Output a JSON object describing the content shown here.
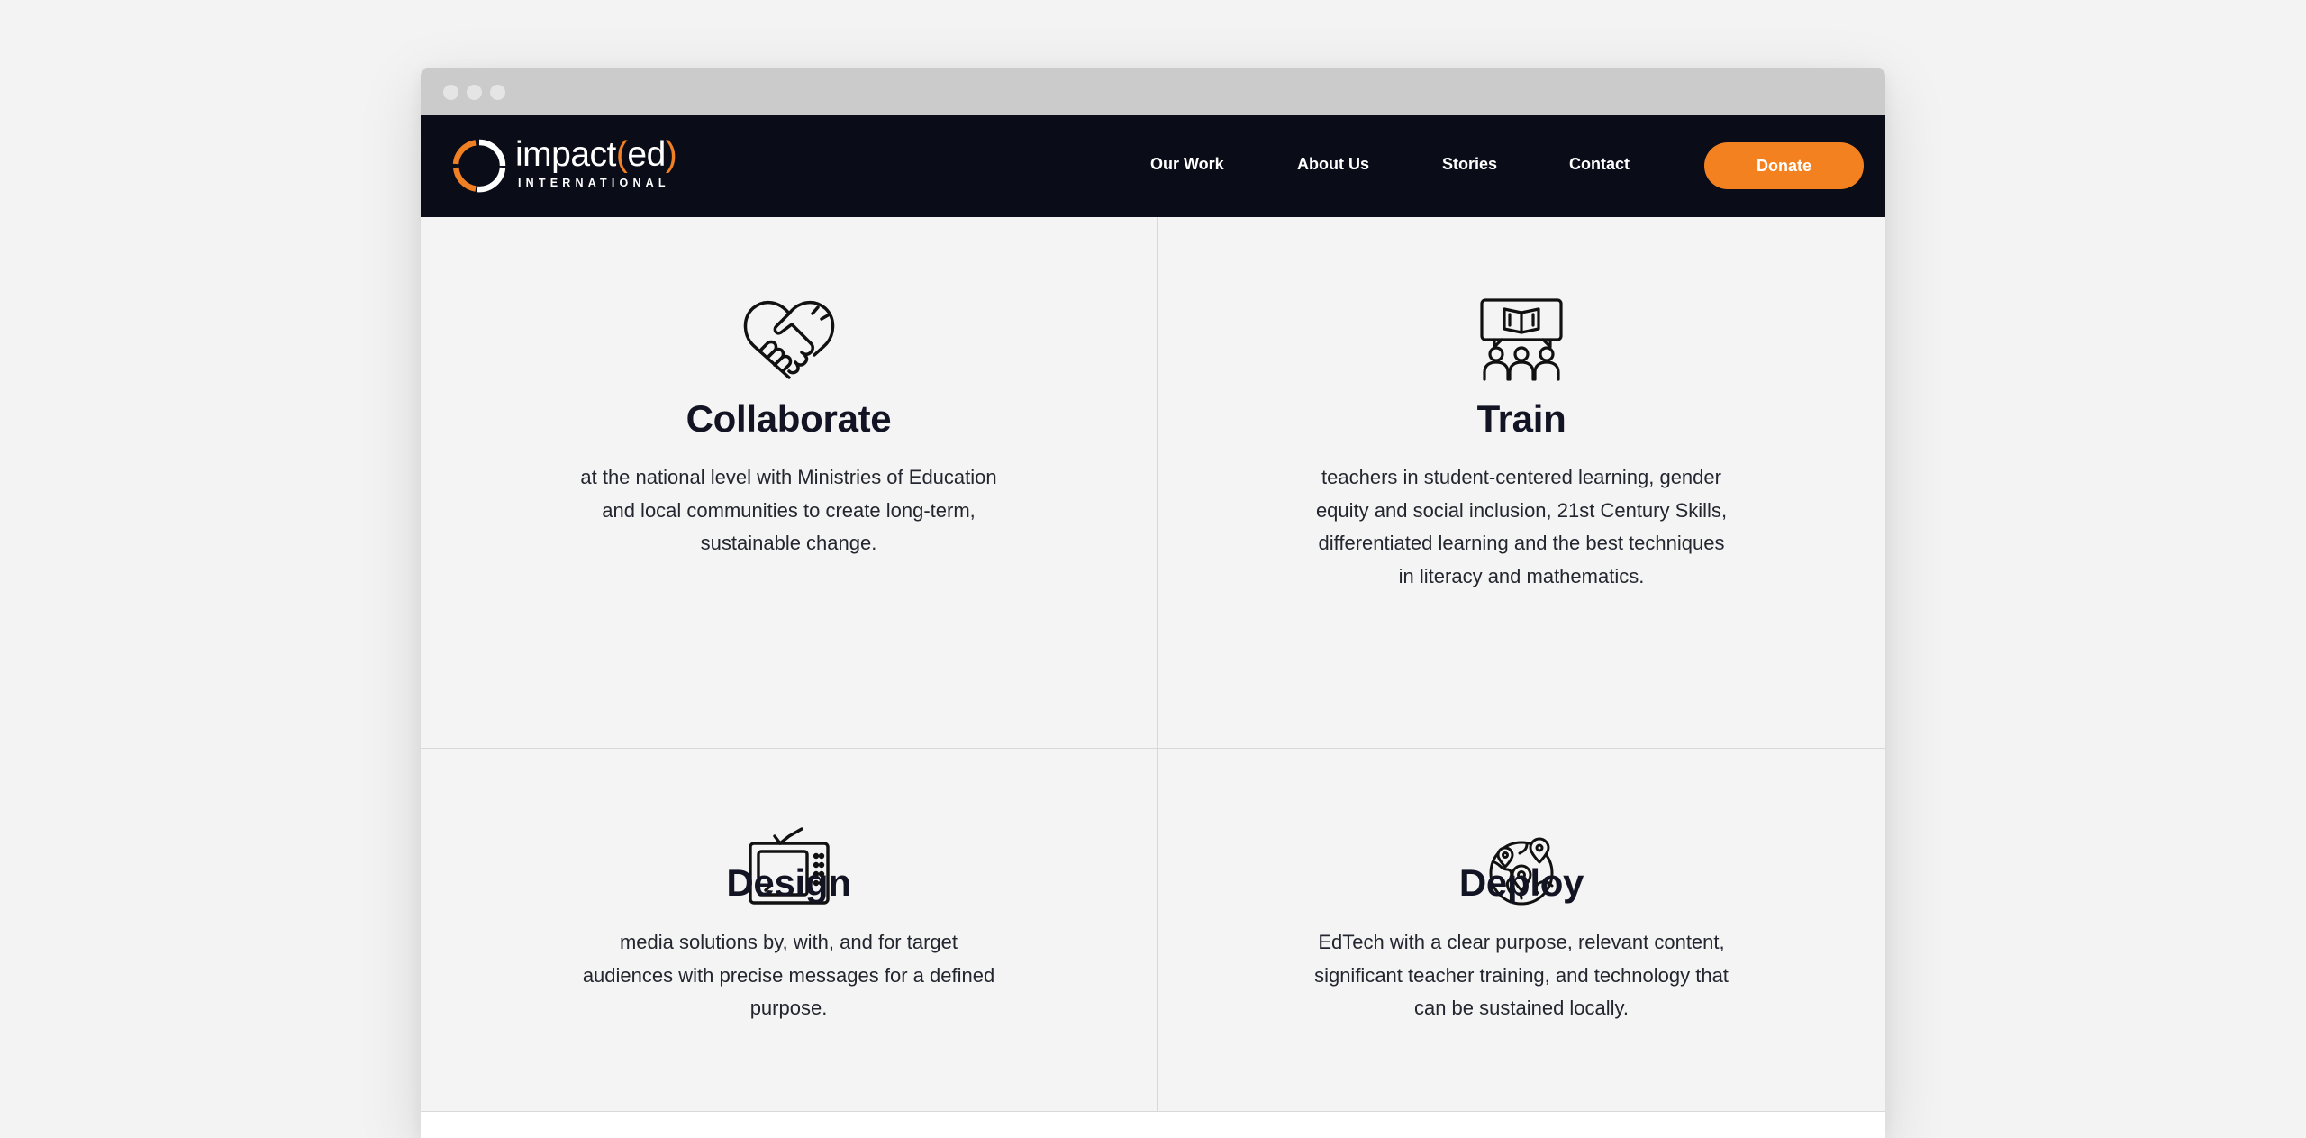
{
  "window": {
    "controls": [
      "close",
      "minimize",
      "maximize"
    ]
  },
  "brand": {
    "logo_text_main": "impact",
    "logo_text_open": "(",
    "logo_text_ed": "ed",
    "logo_text_close": ")",
    "logo_subtitle": "INTERNATIONAL",
    "accent_color": "#f4811f",
    "nav_background": "#0a0c18"
  },
  "nav": {
    "items": [
      {
        "label": "Our Work"
      },
      {
        "label": "About Us"
      },
      {
        "label": "Stories"
      },
      {
        "label": "Contact"
      }
    ],
    "donate_label": "Donate"
  },
  "features": [
    {
      "icon": "handshake-heart-icon",
      "title": "Collaborate",
      "lines": [
        "at the national level with Ministries of Education",
        "and local communities to create long-term,",
        "sustainable change."
      ]
    },
    {
      "icon": "teacher-students-book-icon",
      "title": "Train",
      "lines": [
        "teachers in student-centered learning, gender",
        "equity and social inclusion, 21st Century Skills,",
        "differentiated learning and the best techniques",
        "in literacy and mathematics."
      ]
    },
    {
      "icon": "television-icon",
      "title": "Design",
      "lines": [
        "media solutions by, with, and for target",
        "audiences with precise messages for a defined",
        "purpose."
      ]
    },
    {
      "icon": "globe-pins-icon",
      "title": "Deploy",
      "lines": [
        "EdTech with a clear purpose, relevant content,",
        "significant teacher training, and technology that",
        "can be sustained locally."
      ]
    }
  ]
}
